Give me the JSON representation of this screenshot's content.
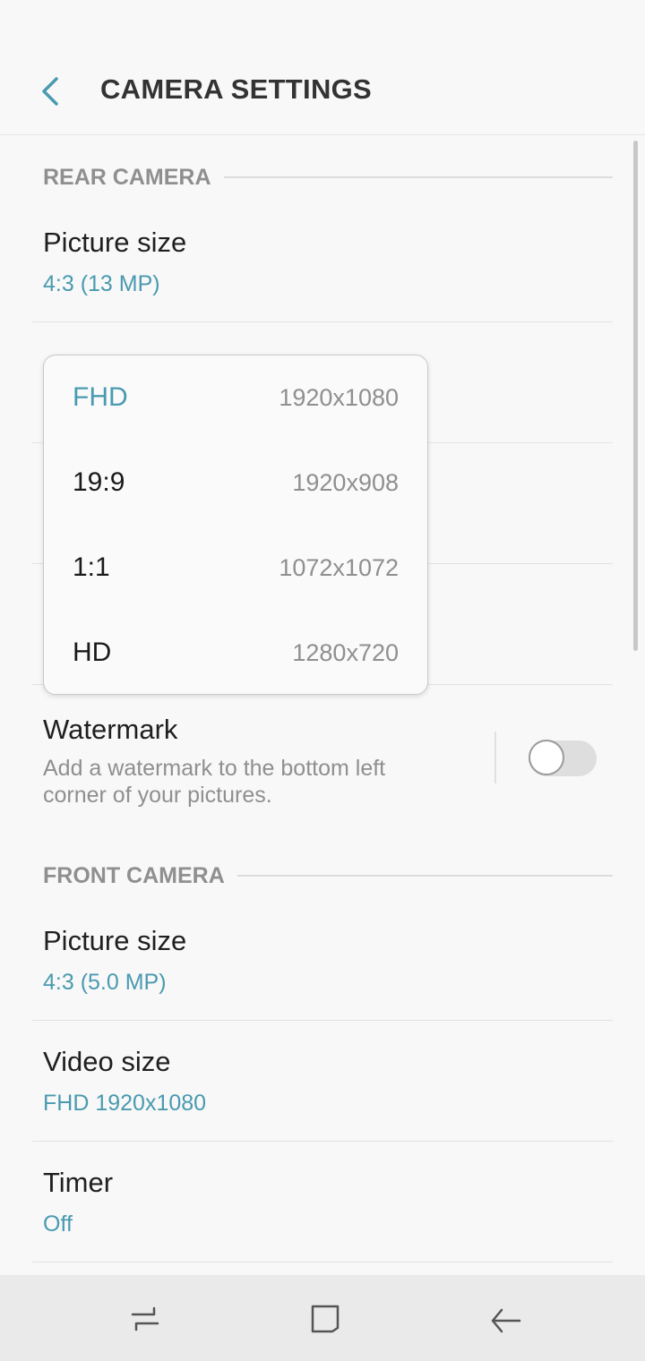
{
  "header": {
    "title": "CAMERA SETTINGS"
  },
  "rear_camera": {
    "section_label": "REAR CAMERA",
    "picture_size": {
      "label": "Picture size",
      "value": "4:3 (13 MP)"
    },
    "watermark": {
      "label": "Watermark",
      "description": "Add a watermark to the bottom left corner of your pictures.",
      "enabled": false
    }
  },
  "video_size_menu": {
    "options": [
      {
        "label": "FHD",
        "resolution": "1920x1080",
        "selected": true
      },
      {
        "label": "19:9",
        "resolution": "1920x908",
        "selected": false
      },
      {
        "label": "1:1",
        "resolution": "1072x1072",
        "selected": false
      },
      {
        "label": "HD",
        "resolution": "1280x720",
        "selected": false
      }
    ]
  },
  "front_camera": {
    "section_label": "FRONT CAMERA",
    "picture_size": {
      "label": "Picture size",
      "value": "4:3 (5.0 MP)"
    },
    "video_size": {
      "label": "Video size",
      "value": "FHD 1920x1080"
    },
    "timer": {
      "label": "Timer",
      "value": "Off"
    }
  },
  "colors": {
    "accent": "#4a9ab0",
    "background": "#f8f8f8",
    "secondary_text": "#8f8f8f"
  },
  "icons": {
    "back": "chevron-left-icon",
    "recents": "recents-icon",
    "home": "home-icon",
    "nav_back": "back-arrow-icon"
  }
}
